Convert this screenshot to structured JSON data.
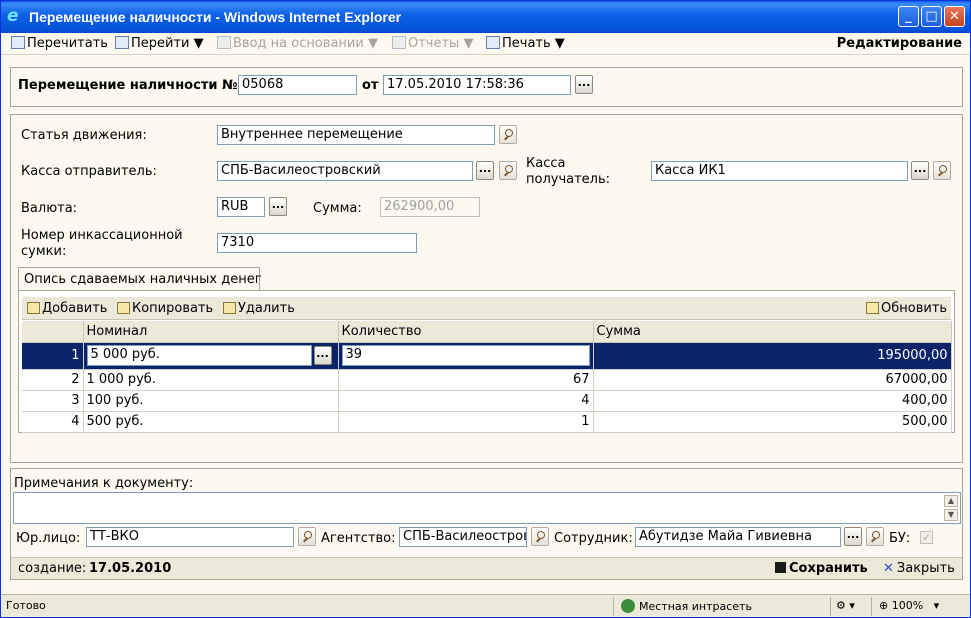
{
  "window": {
    "title": "Перемещение наличности - Windows Internet Explorer",
    "minimize": "_",
    "maximize": "□",
    "close": "✕"
  },
  "toolbar": {
    "reread": "Перечитать",
    "goto": "Перейти ▼",
    "based_on": "Ввод на основании ▼",
    "reports": "Отчеты ▼",
    "print": "Печать ▼",
    "mode": "Редактирование"
  },
  "doc": {
    "title_label": "Перемещение наличности №",
    "number": "05068",
    "from_label": "от",
    "date": "17.05.2010 17:58:36",
    "dots": "..."
  },
  "form": {
    "article_label": "Статья движения:",
    "article_value": "Внутреннее перемещение",
    "sender_label": "Касса отправитель:",
    "sender_value": "СПБ-Василеостровский",
    "receiver_label_1": "Касса",
    "receiver_label_2": "получатель:",
    "receiver_value": "Касса ИК1",
    "currency_label": "Валюта:",
    "currency_value": "RUB",
    "sum_label": "Сумма:",
    "sum_value": "262900,00",
    "bag_label_1": "Номер инкассационной",
    "bag_label_2": "сумки:",
    "bag_value": "7310"
  },
  "tab": {
    "label": "Опись сдаваемых наличных денег"
  },
  "grid": {
    "add": "Добавить",
    "copy": "Копировать",
    "delete": "Удалить",
    "refresh": "Обновить",
    "columns": [
      "Номинал",
      "Количество",
      "Сумма"
    ],
    "rows": [
      {
        "n": "1",
        "nominal": "5 000 руб.",
        "qty": "39",
        "sum": "195000,00"
      },
      {
        "n": "2",
        "nominal": "1 000 руб.",
        "qty": "67",
        "sum": "67000,00"
      },
      {
        "n": "3",
        "nominal": "100 руб.",
        "qty": "4",
        "sum": "400,00"
      },
      {
        "n": "4",
        "nominal": "500 руб.",
        "qty": "1",
        "sum": "500,00"
      }
    ]
  },
  "bottom": {
    "notes_label": "Примечания к документу:",
    "legal_label": "Юр.лицо:",
    "legal_value": "ТТ-ВКО",
    "agency_label": "Агентство:",
    "agency_value": "СПБ-Василеостров",
    "employee_label": "Сотрудник:",
    "employee_value": "Абутидзе Майа Гивиевна",
    "bu_label": "БУ:",
    "created_label": "создание:",
    "created_value": "17.05.2010",
    "save": "Сохранить",
    "close": "Закрыть"
  },
  "status": {
    "ready": "Готово",
    "zone": "Местная интрасеть",
    "zoom": "100%"
  }
}
